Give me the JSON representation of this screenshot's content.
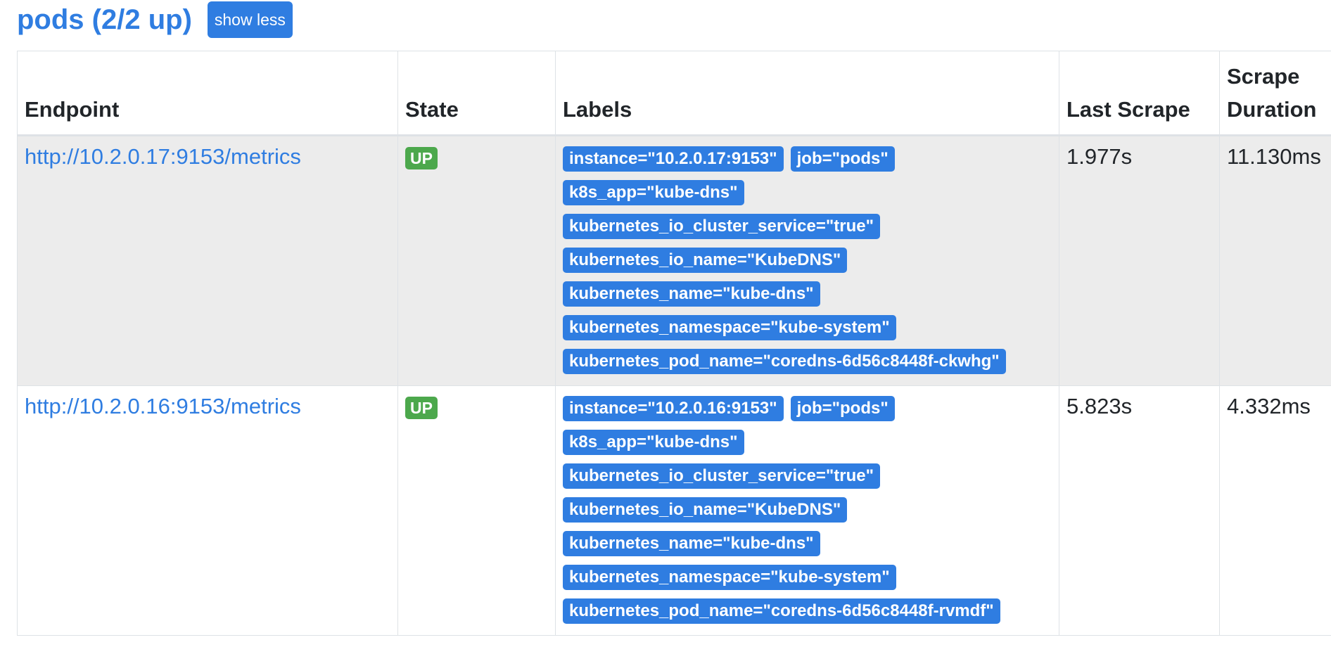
{
  "header": {
    "title": "pods (2/2 up)",
    "toggle_label": "show less"
  },
  "table": {
    "columns": [
      "Endpoint",
      "State",
      "Labels",
      "Last Scrape",
      "Scrape Duration"
    ],
    "rows": [
      {
        "endpoint": "http://10.2.0.17:9153/metrics",
        "state": "UP",
        "labels": [
          "instance=\"10.2.0.17:9153\"",
          "job=\"pods\"",
          "k8s_app=\"kube-dns\"",
          "kubernetes_io_cluster_service=\"true\"",
          "kubernetes_io_name=\"KubeDNS\"",
          "kubernetes_name=\"kube-dns\"",
          "kubernetes_namespace=\"kube-system\"",
          "kubernetes_pod_name=\"coredns-6d56c8448f-ckwhg\""
        ],
        "last_scrape": "1.977s",
        "scrape_duration": "11.130ms"
      },
      {
        "endpoint": "http://10.2.0.16:9153/metrics",
        "state": "UP",
        "labels": [
          "instance=\"10.2.0.16:9153\"",
          "job=\"pods\"",
          "k8s_app=\"kube-dns\"",
          "kubernetes_io_cluster_service=\"true\"",
          "kubernetes_io_name=\"KubeDNS\"",
          "kubernetes_name=\"kube-dns\"",
          "kubernetes_namespace=\"kube-system\"",
          "kubernetes_pod_name=\"coredns-6d56c8448f-rvmdf\""
        ],
        "last_scrape": "5.823s",
        "scrape_duration": "4.332ms"
      }
    ]
  },
  "colors": {
    "accent": "#2f7de1",
    "state_up": "#4ca84c",
    "row_stripe": "#ececec"
  }
}
